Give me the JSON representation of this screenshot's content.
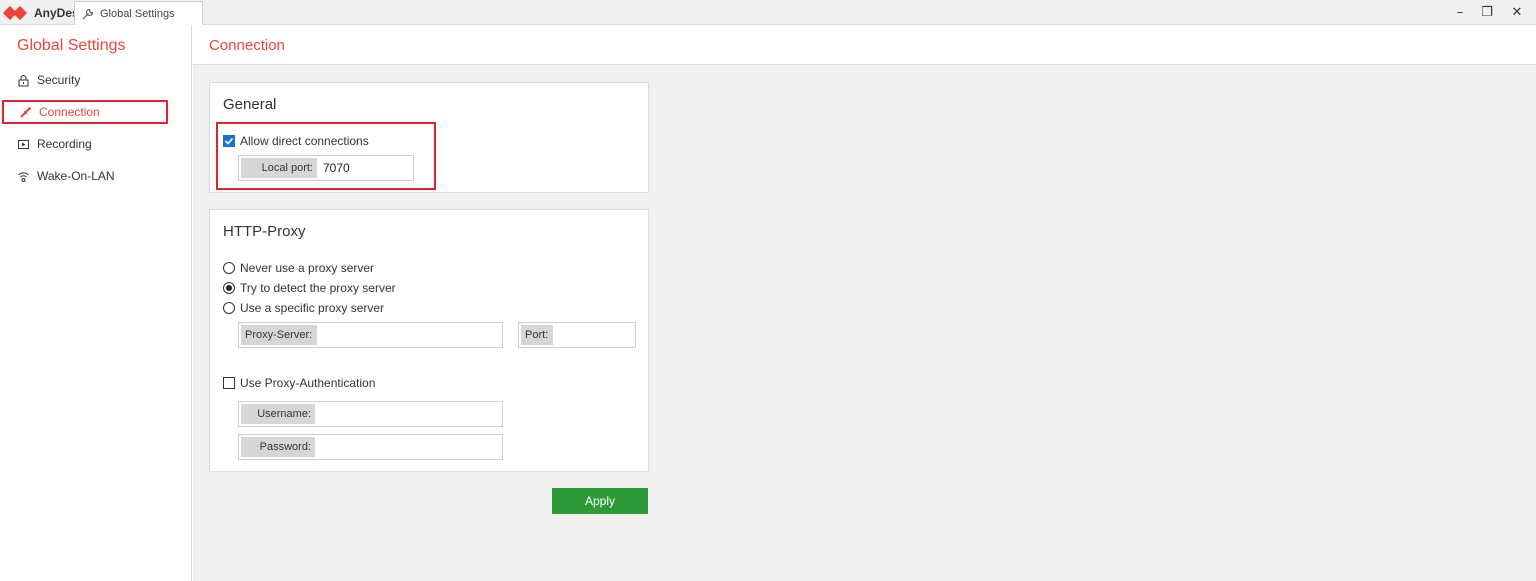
{
  "titlebar": {
    "brand": "AnyDesk",
    "tab_label": "Global Settings",
    "minimize_glyph": "–",
    "restore_glyph": "❐",
    "close_glyph": "✕"
  },
  "sidebar": {
    "title": "Global Settings",
    "items": [
      {
        "label": "Security",
        "icon": "lock-icon"
      },
      {
        "label": "Connection",
        "icon": "connection-icon",
        "active": true
      },
      {
        "label": "Recording",
        "icon": "recording-icon"
      },
      {
        "label": "Wake-On-LAN",
        "icon": "wifi-icon"
      }
    ]
  },
  "main": {
    "title": "Connection",
    "general": {
      "title": "General",
      "allow_direct_label": "Allow direct connections",
      "allow_direct_checked": true,
      "local_port_label": "Local port:",
      "local_port_value": "7070"
    },
    "proxy": {
      "title": "HTTP-Proxy",
      "options": [
        {
          "label": "Never use a proxy server",
          "selected": false
        },
        {
          "label": "Try to detect the proxy server",
          "selected": true
        },
        {
          "label": "Use a specific proxy server",
          "selected": false
        }
      ],
      "server_label": "Proxy-Server:",
      "server_value": "",
      "port_label": "Port:",
      "port_value": "",
      "auth_label": "Use Proxy-Authentication",
      "auth_checked": false,
      "username_label": "Username:",
      "username_value": "",
      "password_label": "Password:",
      "password_value": ""
    },
    "apply_label": "Apply"
  },
  "colors": {
    "accent": "#ef443b",
    "highlight": "#e0242a",
    "apply_green": "#2e9a3a",
    "checkbox_blue": "#1f6fd1"
  }
}
